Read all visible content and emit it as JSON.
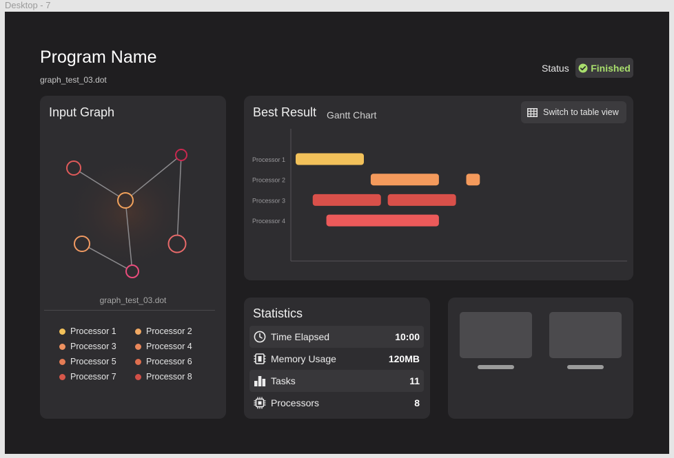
{
  "frame": {
    "label": "Desktop - 7"
  },
  "header": {
    "program_name": "Program Name",
    "file_name": "graph_test_03.dot",
    "status_label": "Status",
    "status_value": "Finished",
    "status_color": "#a9df6d"
  },
  "input_graph": {
    "title": "Input Graph",
    "caption": "graph_test_03.dot",
    "nodes": [
      {
        "id": "n1",
        "color": "#e05a5a"
      },
      {
        "id": "n2",
        "color": "#c9284f"
      },
      {
        "id": "n3",
        "color": "#f4a35c"
      },
      {
        "id": "n4",
        "color": "#f19a62"
      },
      {
        "id": "n5",
        "color": "#e86a6a"
      },
      {
        "id": "n6",
        "color": "#e94c7c"
      }
    ],
    "edges": [
      [
        "n1",
        "n3"
      ],
      [
        "n2",
        "n3"
      ],
      [
        "n2",
        "n5"
      ],
      [
        "n3",
        "n6"
      ],
      [
        "n4",
        "n6"
      ]
    ],
    "legend": [
      {
        "label": "Processor 1",
        "color": "#f2c15a"
      },
      {
        "label": "Processor 2",
        "color": "#f1a963"
      },
      {
        "label": "Processor 3",
        "color": "#ee9160"
      },
      {
        "label": "Processor 4",
        "color": "#e9875a"
      },
      {
        "label": "Processor 5",
        "color": "#e57c55"
      },
      {
        "label": "Processor 6",
        "color": "#df6f4f"
      },
      {
        "label": "Processor 7",
        "color": "#d7574a"
      },
      {
        "label": "Processor 8",
        "color": "#d14f47"
      }
    ]
  },
  "best_result": {
    "title": "Best Result",
    "subtitle": "Gantt Chart",
    "switch_label": "Switch to table view"
  },
  "chart_data": {
    "type": "bar",
    "orientation": "horizontal-gantt",
    "categories": [
      "Processor 1",
      "Processor 2",
      "Processor 3",
      "Processor 4"
    ],
    "xlim": [
      0,
      10
    ],
    "tasks": [
      {
        "processor": "Processor 1",
        "start": 0.0,
        "end": 2.0,
        "color": "#f2c15a"
      },
      {
        "processor": "Processor 2",
        "start": 2.2,
        "end": 4.2,
        "color": "#f49a5c"
      },
      {
        "processor": "Processor 2",
        "start": 5.0,
        "end": 5.4,
        "color": "#f49a5c"
      },
      {
        "processor": "Processor 3",
        "start": 0.5,
        "end": 2.5,
        "color": "#d9504a"
      },
      {
        "processor": "Processor 3",
        "start": 2.7,
        "end": 4.7,
        "color": "#d9504a"
      },
      {
        "processor": "Processor 4",
        "start": 0.9,
        "end": 4.2,
        "color": "#ec5a5a"
      }
    ]
  },
  "statistics": {
    "title": "Statistics",
    "rows": [
      {
        "icon": "clock-icon",
        "label": "Time Elapsed",
        "value": "10:00"
      },
      {
        "icon": "memory-icon",
        "label": "Memory Usage",
        "value": "120MB"
      },
      {
        "icon": "bar-chart-icon",
        "label": "Tasks",
        "value": "11"
      },
      {
        "icon": "processor-icon",
        "label": "Processors",
        "value": "8"
      }
    ]
  }
}
